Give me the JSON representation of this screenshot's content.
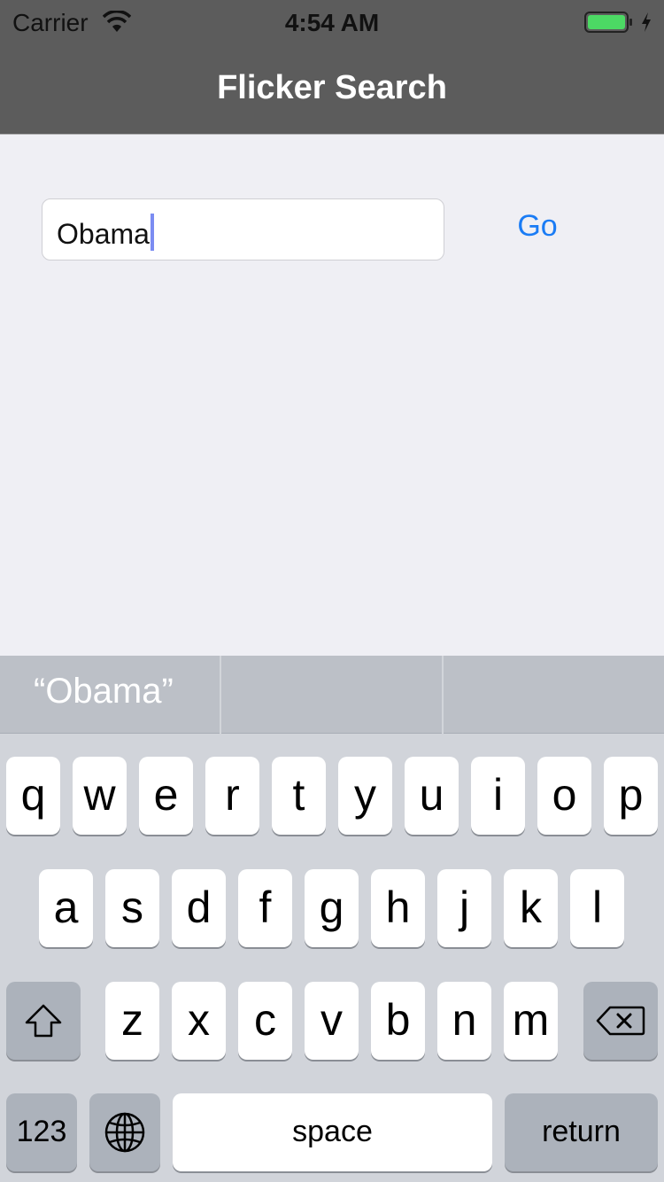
{
  "status_bar": {
    "carrier": "Carrier",
    "time": "4:54 AM",
    "wifi_icon": "wifi-icon",
    "battery_icon": "battery-icon",
    "battery_color": "#4cd964"
  },
  "nav": {
    "title": "Flicker Search",
    "background": "#5c5c5c"
  },
  "search": {
    "value": "Obama",
    "go_label": "Go",
    "accent": "#1a7cf5"
  },
  "keyboard": {
    "predictions": [
      "“Obama”",
      "",
      ""
    ],
    "row1": [
      "q",
      "w",
      "e",
      "r",
      "t",
      "y",
      "u",
      "i",
      "o",
      "p"
    ],
    "row2": [
      "a",
      "s",
      "d",
      "f",
      "g",
      "h",
      "j",
      "k",
      "l"
    ],
    "row3": [
      "z",
      "x",
      "c",
      "v",
      "b",
      "n",
      "m"
    ],
    "shift_icon": "shift-icon",
    "backspace_icon": "backspace-icon",
    "numbers_label": "123",
    "globe_icon": "globe-icon",
    "space_label": "space",
    "return_label": "return"
  }
}
